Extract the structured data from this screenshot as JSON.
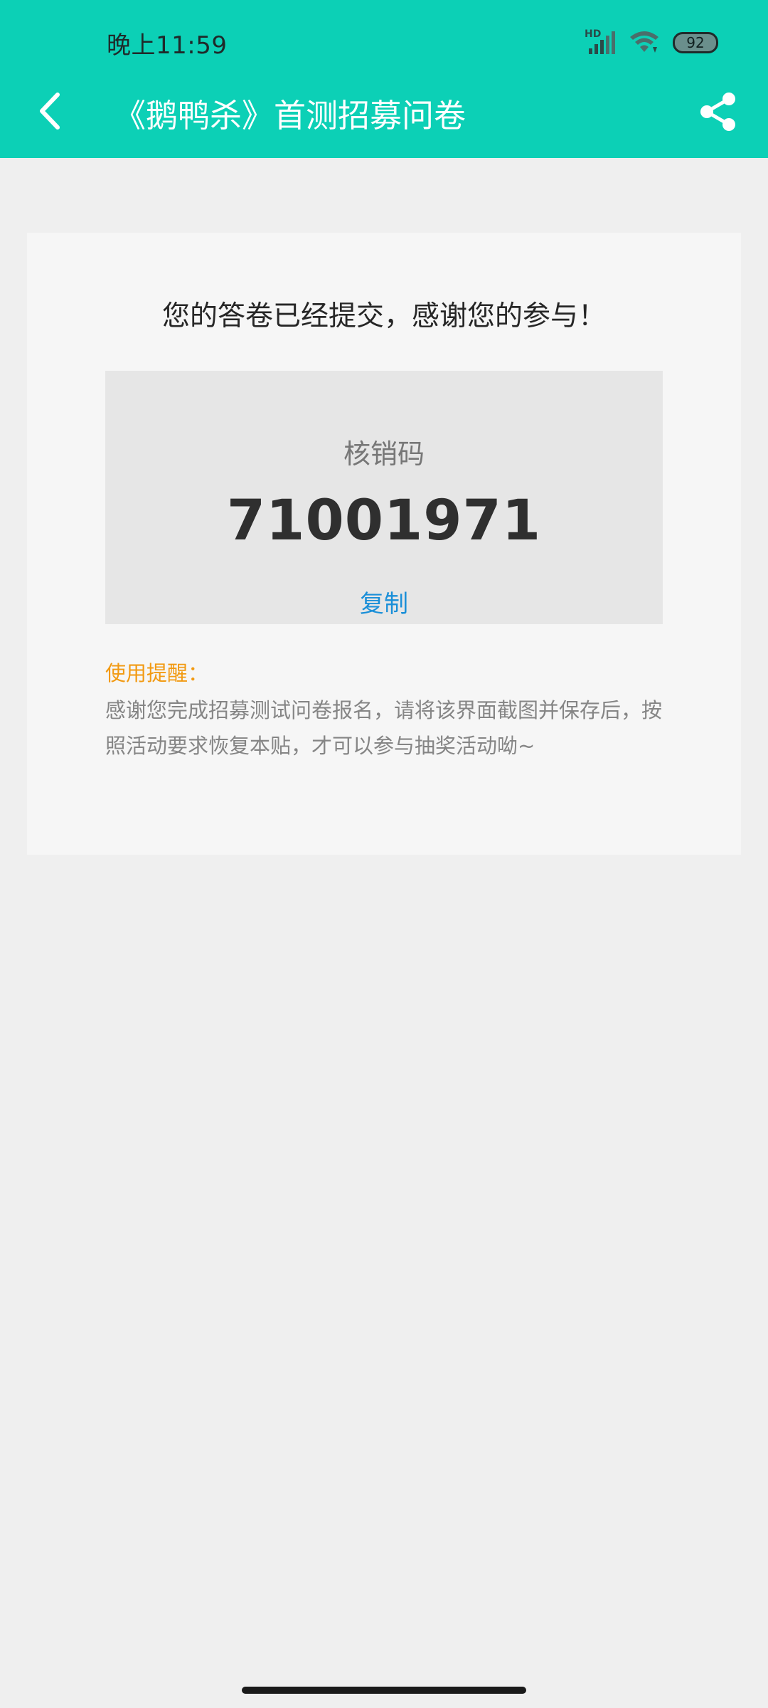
{
  "status_bar": {
    "time": "晚上11:59",
    "signal_label": "HD",
    "battery": "92",
    "icons": [
      "signal-icon",
      "wifi-icon",
      "battery-icon"
    ]
  },
  "header": {
    "title": "《鹅鸭杀》首测招募问卷",
    "back_icon": "chevron-left-icon",
    "share_icon": "share-icon",
    "background_color": "#0cd0b6"
  },
  "result": {
    "message": "您的答卷已经提交，感谢您的参与！",
    "code_label": "核销码",
    "code_value": "71001971",
    "copy_label": "复制",
    "copy_color": "#1a8fd8"
  },
  "tip": {
    "title": "使用提醒：",
    "body": "感谢您完成招募测试问卷报名，请将该界面截图并保存后，按照活动要求恢复本贴，才可以参与抽奖活动呦~",
    "title_color": "#f29a12"
  }
}
